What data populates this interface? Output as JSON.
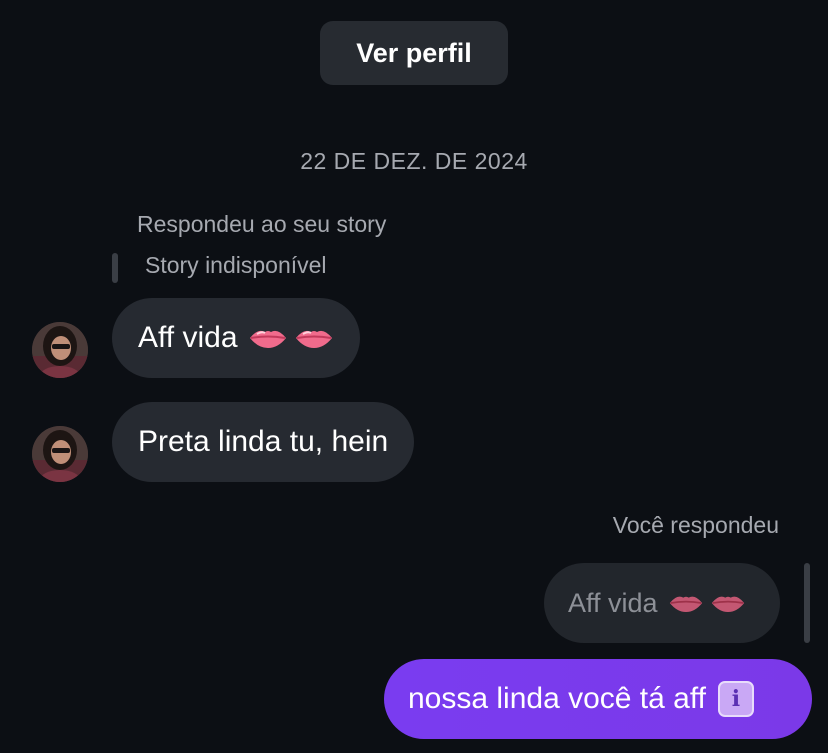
{
  "header": {
    "view_profile_label": "Ver perfil"
  },
  "date_separator": "22 DE DEZ. DE 2024",
  "story_reply": {
    "label": "Respondeu ao seu story",
    "story_status": "Story indisponível"
  },
  "messages_in": [
    {
      "text": "Aff vida",
      "emojis": [
        "lips-emoji",
        "lips-emoji"
      ]
    },
    {
      "text": "Preta linda tu, hein"
    }
  ],
  "reply_block": {
    "label": "Você respondeu",
    "quoted_text": "Aff vida",
    "quoted_emojis": [
      "lips-emoji",
      "lips-emoji"
    ]
  },
  "message_out": {
    "text": "nossa linda você tá aff",
    "emoji": "information-emoji"
  },
  "colors": {
    "background": "#0c0f14",
    "incoming_bubble": "#262a31",
    "outgoing_bubble": "#7b39e8",
    "muted_text": "#a6a9b0"
  }
}
